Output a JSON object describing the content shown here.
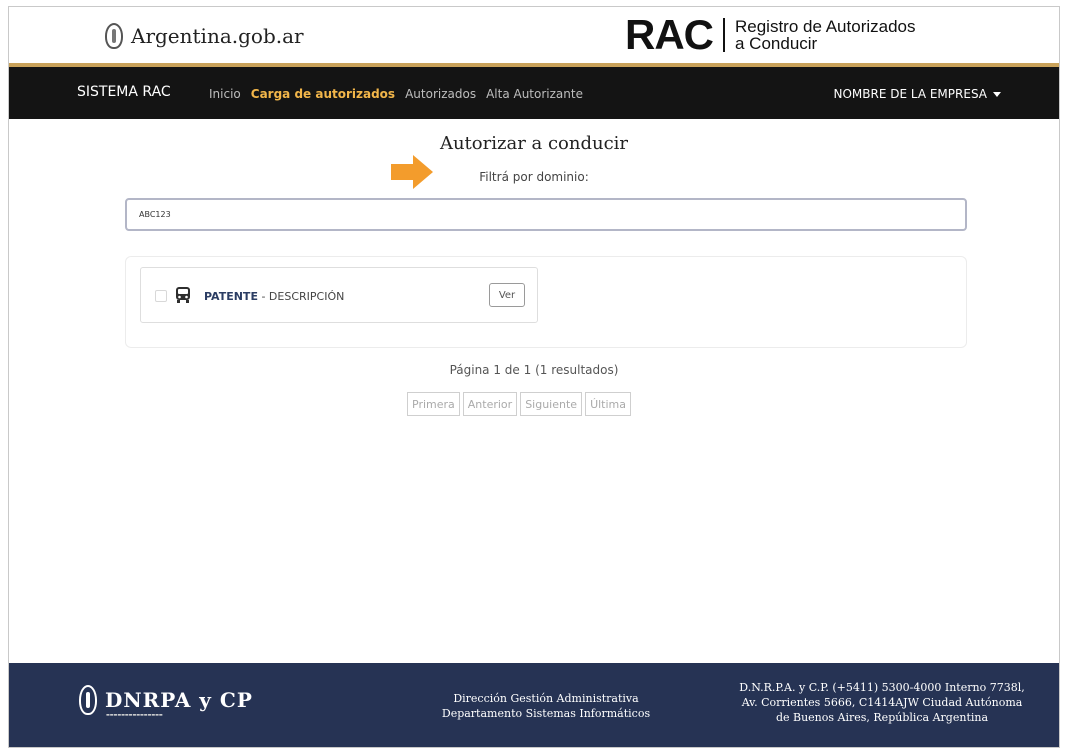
{
  "header": {
    "gov_name": "Argentina.gob.ar",
    "rac_title": "RAC",
    "rac_subtitle_1": "Registro de Autorizados",
    "rac_subtitle_2": "a Conducir"
  },
  "nav": {
    "brand": "SISTEMA RAC",
    "links": [
      {
        "label": "Inicio"
      },
      {
        "label": "Carga de autorizados",
        "active": true
      },
      {
        "label": "Autorizados"
      },
      {
        "label": "Alta Autorizante"
      }
    ],
    "company_menu": "NOMBRE DE LA EMPRESA"
  },
  "main": {
    "title": "Autorizar a conducir",
    "filter_label": "Filtrá por dominio:",
    "search_value": "ABC123",
    "result": {
      "patente": "PATENTE",
      "separator": " - ",
      "descripcion": "DESCRIPCIÓN",
      "view_button": "Ver"
    },
    "pagination_info": "Página 1 de 1 (1 resultados)",
    "pager": {
      "first": "Primera",
      "prev": "Anterior",
      "next": "Siguiente",
      "last": "Última"
    }
  },
  "footer": {
    "logo_text": "DNRPA y CP",
    "mid_line_1": "Dirección Gestión Administrativa",
    "mid_line_2": "Departamento Sistemas Informáticos",
    "right_line_1": "D.N.R.P.A. y C.P. (+5411) 5300-4000 Interno 7738l,",
    "right_line_2": "Av. Corrientes 5666, C1414AJW Ciudad Autónoma",
    "right_line_3": "de Buenos Aires, República Argentina"
  },
  "colors": {
    "accent_gold": "#f2b64a",
    "arrow_orange": "#f39c2c",
    "navbar_bg": "#141414",
    "footer_bg": "#263354",
    "patente_blue": "#2b3d63"
  },
  "icons": {
    "seal": "national-seal-icon",
    "arrow": "arrow-right-icon",
    "bus": "bus-icon",
    "caret": "caret-down-icon"
  }
}
